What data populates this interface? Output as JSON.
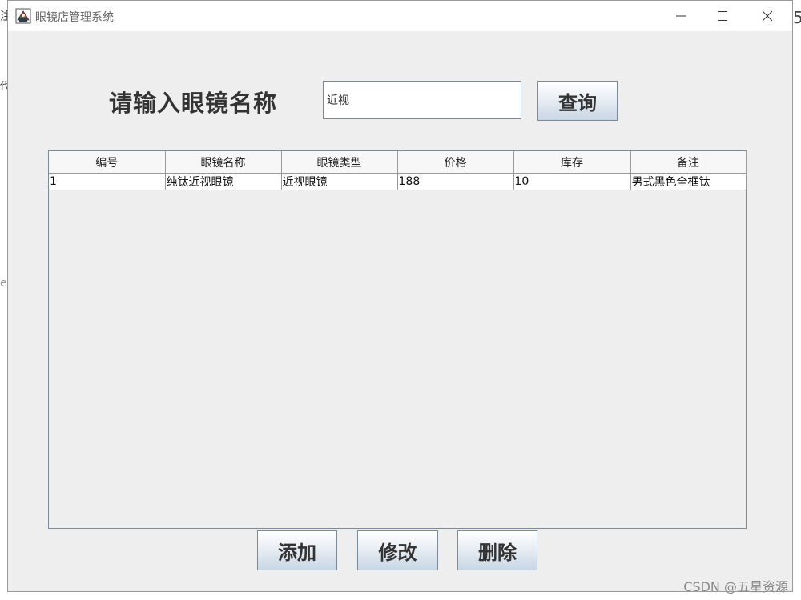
{
  "window": {
    "title": "眼镜店管理系统"
  },
  "search": {
    "prompt": "请输入眼镜名称",
    "value": "近视",
    "query_label": "查询"
  },
  "table": {
    "columns": [
      "编号",
      "眼镜名称",
      "眼镜类型",
      "价格",
      "库存",
      "备注"
    ],
    "rows": [
      [
        "1",
        "纯钛近视眼镜",
        "近视眼镜",
        "188",
        "10",
        "男式黑色全框钛"
      ]
    ]
  },
  "actions": {
    "add_label": "添加",
    "edit_label": "修改",
    "delete_label": "删除"
  },
  "watermark": "CSDN @五星资源",
  "background": {
    "frag_1": "注",
    "frag_2": "代",
    "frag_3": "e",
    "frag_4": "5"
  },
  "colors": {
    "window_bg": "#eeeeee",
    "border": "#7a8a99",
    "button_gradient_end": "#c8d6e4"
  }
}
